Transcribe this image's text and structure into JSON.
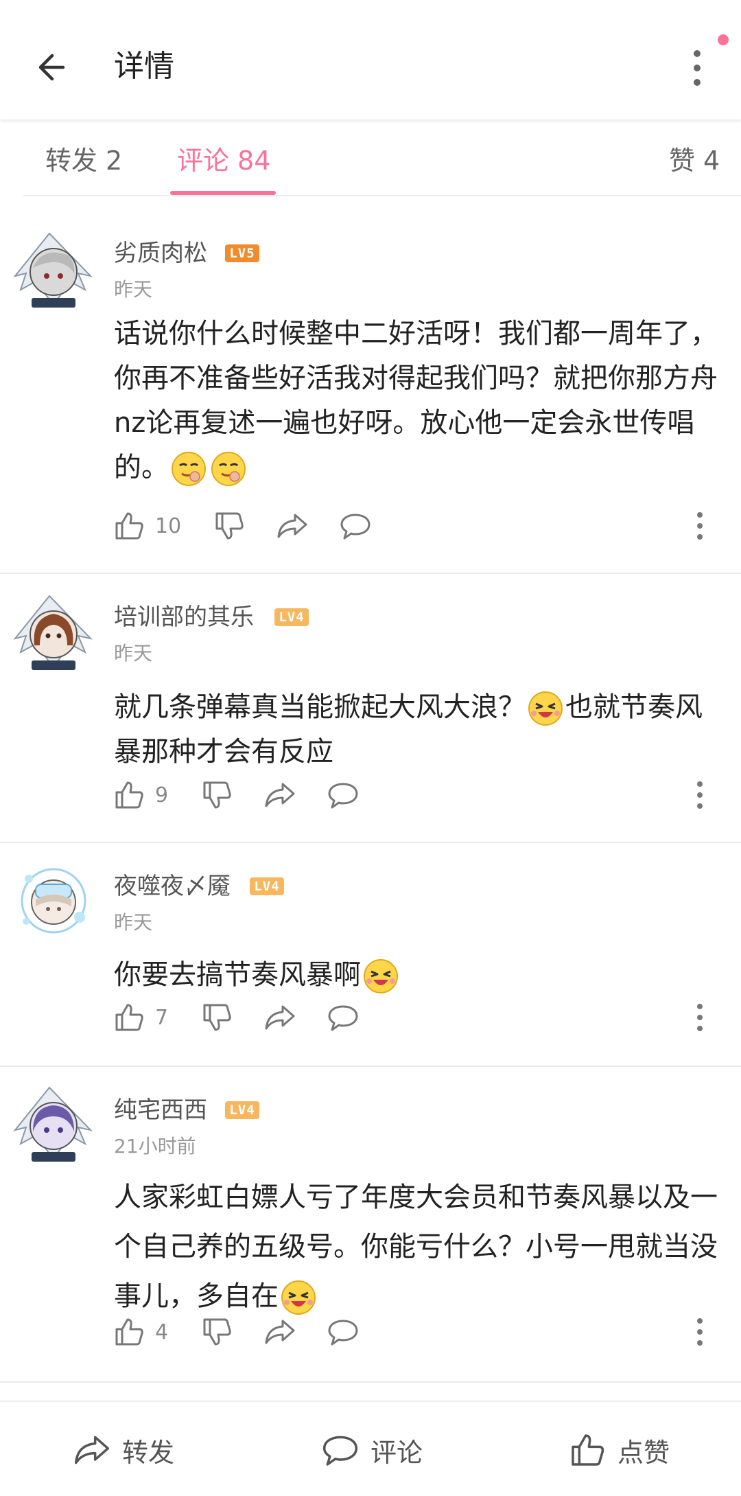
{
  "header": {
    "title": "详情",
    "accent_color": "#fb7299"
  },
  "tabs": [
    {
      "label": "转发",
      "count": "2",
      "active": false
    },
    {
      "label": "评论",
      "count": "84",
      "active": true
    },
    {
      "label": "赞",
      "count": "4",
      "active": false
    }
  ],
  "comments": [
    {
      "username": "劣质肉松",
      "level": "LV5",
      "level_color": "#f08c2e",
      "time": "昨天",
      "text_parts": [
        "话说你什么时候整中二好活呀！我们都一周年了，你再不准备些好活我对得起我们吗？就把你那方舟nz论再复述一遍也好呀。放心他一定会永世传唱的。"
      ],
      "emojis": [
        "smug-face-emoji",
        "smug-face-emoji"
      ],
      "likes": "10",
      "avatar": "avatar-silver-hair-pendant"
    },
    {
      "username": "培训部的其乐",
      "level": "LV4",
      "level_color": "#f6b75f",
      "time": "昨天",
      "text_before": "就几条弹幕真当能掀起大风大浪？",
      "text_after": "也就节奏风暴那种才会有反应",
      "emoji": "laughing-face-emoji",
      "likes": "9",
      "avatar": "avatar-brown-hair-pendant"
    },
    {
      "username": "夜噬夜〆魇",
      "level": "LV4",
      "level_color": "#f6b75f",
      "time": "昨天",
      "text_before": "你要去搞节奏风暴啊",
      "emoji": "laughing-face-emoji",
      "likes": "7",
      "avatar": "avatar-diving-pendant"
    },
    {
      "username": "纯宅西西",
      "level": "LV4",
      "level_color": "#f6b75f",
      "time": "21小时前",
      "text_before": "人家彩虹白嫖人亏了年度大会员和节奏风暴以及一个自己养的五级号。你能亏什么？小号一甩就当没事儿，多自在",
      "emoji": "laughing-face-emoji",
      "likes": "4",
      "avatar": "avatar-purple-hair-pendant"
    }
  ],
  "bottom_bar": {
    "repost": "转发",
    "comment": "评论",
    "like": "点赞"
  },
  "icons": {
    "back": "back-arrow-icon",
    "more": "more-vertical-icon",
    "like": "thumbs-up-icon",
    "dislike": "thumbs-down-icon",
    "share": "share-icon",
    "reply": "comment-bubble-icon"
  }
}
